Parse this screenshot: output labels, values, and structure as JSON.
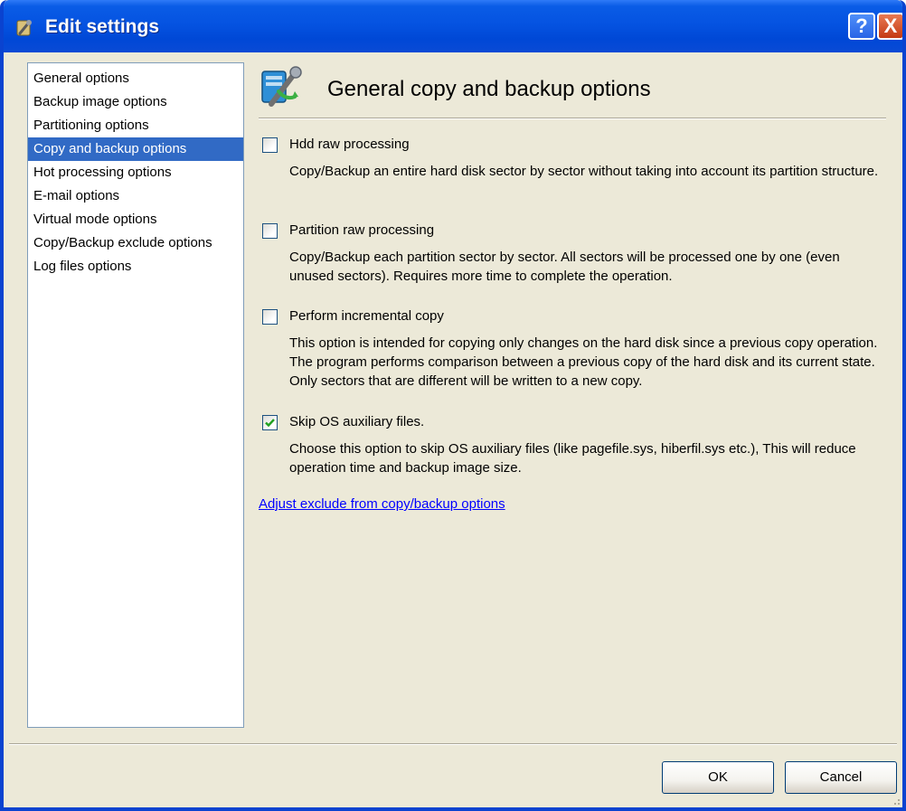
{
  "window": {
    "title": "Edit settings",
    "help_label": "?",
    "close_label": "X"
  },
  "sidebar": {
    "items": [
      {
        "label": "General options"
      },
      {
        "label": "Backup image options"
      },
      {
        "label": "Partitioning options"
      },
      {
        "label": "Copy and backup options",
        "selected": true
      },
      {
        "label": "Hot processing options"
      },
      {
        "label": "E-mail options"
      },
      {
        "label": "Virtual mode options"
      },
      {
        "label": "Copy/Backup exclude options"
      },
      {
        "label": "Log files options"
      }
    ]
  },
  "content": {
    "title": "General copy and backup options",
    "options": [
      {
        "label": "Hdd raw processing",
        "checked": false,
        "description": "Copy/Backup an entire hard disk sector by sector without taking into account its partition structure."
      },
      {
        "label": "Partition raw processing",
        "checked": false,
        "description": "Copy/Backup each partition sector by sector. All sectors will be processed one by one (even unused sectors). Requires more time to complete the operation."
      },
      {
        "label": "Perform incremental copy",
        "checked": false,
        "description": "This option is intended for copying only changes on the hard disk since a previous copy operation. The program performs comparison between a previous copy of the hard disk and its current state. Only sectors that are different will be written to a new copy."
      },
      {
        "label": "Skip OS auxiliary files.",
        "checked": true,
        "description": "Choose this option to skip OS auxiliary files (like pagefile.sys, hiberfil.sys etc.), This will reduce operation time and backup image size."
      }
    ],
    "link_label": "Adjust exclude from copy/backup options"
  },
  "buttons": {
    "ok_label": "OK",
    "cancel_label": "Cancel"
  },
  "icons": {
    "title": "settings-wrench-icon",
    "header": "copy-backup-options-icon",
    "checkmark": "checkmark-icon"
  },
  "colors": {
    "titlebar": "#0553e1",
    "selection": "#316ac5",
    "link": "#0000ff",
    "dialog_bg": "#ece9d8"
  }
}
